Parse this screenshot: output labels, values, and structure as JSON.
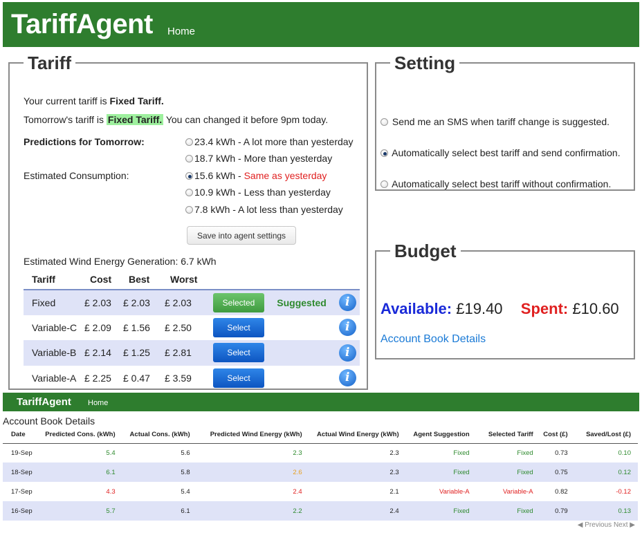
{
  "header": {
    "brand": "TariffAgent",
    "home": "Home"
  },
  "tariff": {
    "legend": "Tariff",
    "current_prefix": "Your current tariff is ",
    "current_value": "Fixed Tariff.",
    "tomorrow_prefix": "Tomorrow's tariff is ",
    "tomorrow_value": "Fixed Tariff.",
    "tomorrow_suffix": " You can changed it before 9pm today.",
    "predictions_label": "Predictions for Tomorrow:",
    "est_consumption_label": "Estimated Consumption:",
    "options": [
      {
        "text": "23.4 kWh - A lot more than yesterday"
      },
      {
        "text": "18.7 kWh - More than yesterday"
      },
      {
        "kwh": "15.6 kWh - ",
        "desc": "Same as yesterday"
      },
      {
        "text": "10.9 kWh - Less than yesterday"
      },
      {
        "text": "7.8 kWh - A lot less than yesterday"
      }
    ],
    "selected_option": 2,
    "save_button": "Save into agent settings",
    "wind_label": "Estimated Wind Energy Generation: ",
    "wind_value": "6.7 kWh",
    "table": {
      "headers": [
        "Tariff",
        "Cost",
        "Best",
        "Worst"
      ],
      "rows": [
        {
          "name": "Fixed",
          "cost": "£ 2.03",
          "best": "£ 2.03",
          "worst": "£ 2.03",
          "button": "Selected",
          "status": "Suggested"
        },
        {
          "name": "Variable-C",
          "cost": "£ 2.09",
          "best": "£ 1.56",
          "worst": "£ 2.50",
          "button": "Select",
          "status": ""
        },
        {
          "name": "Variable-B",
          "cost": "£ 2.14",
          "best": "£ 1.25",
          "worst": "£ 2.81",
          "button": "Select",
          "status": ""
        },
        {
          "name": "Variable-A",
          "cost": "£ 2.25",
          "best": "£ 0.47",
          "worst": "£ 3.59",
          "button": "Select",
          "status": ""
        }
      ]
    }
  },
  "setting": {
    "legend": "Setting",
    "options": [
      "Send me an SMS when tariff change is suggested.",
      "Automatically select best tariff and send confirmation.",
      "Automatically select best tariff without confirmation."
    ],
    "selected_option": 1
  },
  "budget": {
    "legend": "Budget",
    "available_label": "Available:",
    "available_value": "£19.40",
    "spent_label": "Spent:",
    "spent_value": "£10.60",
    "link": "Account Book Details"
  },
  "footer_bar": {
    "brand": "TariffAgent",
    "home": "Home"
  },
  "account_book": {
    "title": "Account Book Details",
    "headers": [
      "Date",
      "Predicted Cons. (kWh)",
      "Actual Cons. (kWh)",
      "Predicted Wind Energy (kWh)",
      "Actual Wind Energy (kWh)",
      "Agent Suggestion",
      "Selected Tariff",
      "Cost (£)",
      "Saved/Lost (£)"
    ],
    "rows": [
      [
        "19-Sep",
        "5.4",
        "5.6",
        "2.3",
        "2.3",
        "Fixed",
        "Fixed",
        "0.73",
        "0.10"
      ],
      [
        "18-Sep",
        "6.1",
        "5.8",
        "2.6",
        "2.3",
        "Fixed",
        "Fixed",
        "0.75",
        "0.12"
      ],
      [
        "17-Sep",
        "4.3",
        "5.4",
        "2.4",
        "2.1",
        "Variable-A",
        "Variable-A",
        "0.82",
        "-0.12"
      ],
      [
        "16-Sep",
        "5.7",
        "6.1",
        "2.2",
        "2.4",
        "Fixed",
        "Fixed",
        "0.79",
        "0.13"
      ]
    ],
    "pager": {
      "previous": "Previous",
      "next": "Next"
    }
  },
  "colors": {
    "header_green": "#2e7d2e",
    "highlight": "#9ef09e",
    "row_shade": "#dfe3f7",
    "accent_blue": "#1a2ad8",
    "accent_red": "#e02020"
  }
}
